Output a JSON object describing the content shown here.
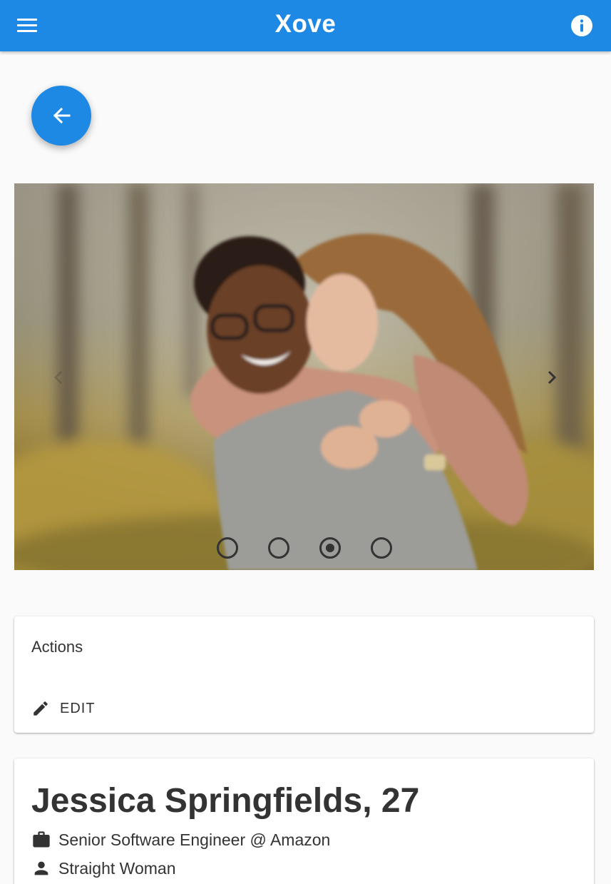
{
  "app": {
    "title": "Xove",
    "brand_color": "#1e88e5",
    "menu_icon": "menu-icon",
    "info_icon": "info-icon"
  },
  "back_button": {
    "icon": "arrow-left-icon"
  },
  "carousel": {
    "photo": "couple-piggyback-outdoors",
    "prev_icon": "chevron-left-icon",
    "next_icon": "chevron-right-icon",
    "slide_count": 4,
    "active_index": 2
  },
  "actions": {
    "title": "Actions",
    "edit_label": "EDIT",
    "edit_icon": "pencil-icon"
  },
  "profile": {
    "name_age": "Jessica Springfields, 27",
    "job": "Senior Software Engineer @ Amazon",
    "job_icon": "briefcase-icon",
    "orientation": "Straight Woman",
    "orientation_icon": "person-icon"
  }
}
